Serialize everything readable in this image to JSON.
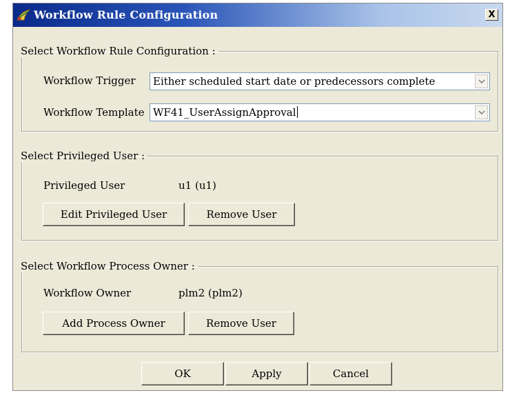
{
  "window": {
    "title": "Workflow Rule Configuration",
    "close_glyph": "X",
    "icon": "workflow-app-icon"
  },
  "rule_config": {
    "legend": "Select Workflow Rule Configuration :",
    "trigger_label": "Workflow Trigger",
    "trigger_value": "Either scheduled start date or predecessors complete",
    "template_label": "Workflow Template",
    "template_value": "WF41_UserAssignApproval"
  },
  "privileged_user": {
    "legend": "Select Privileged User :",
    "label": "Privileged User",
    "value": "u1 (u1)",
    "edit_button": "Edit Privileged User",
    "remove_button": "Remove User"
  },
  "process_owner": {
    "legend": "Select Workflow Process Owner :",
    "label": "Workflow Owner",
    "value": "plm2 (plm2)",
    "add_button": "Add Process Owner",
    "remove_button": "Remove User"
  },
  "footer": {
    "ok": "OK",
    "apply": "Apply",
    "cancel": "Cancel"
  },
  "colors": {
    "titlebar_start": "#0a2a8a",
    "titlebar_end": "#c9d9ef",
    "dialog_bg": "#ece9d8"
  }
}
